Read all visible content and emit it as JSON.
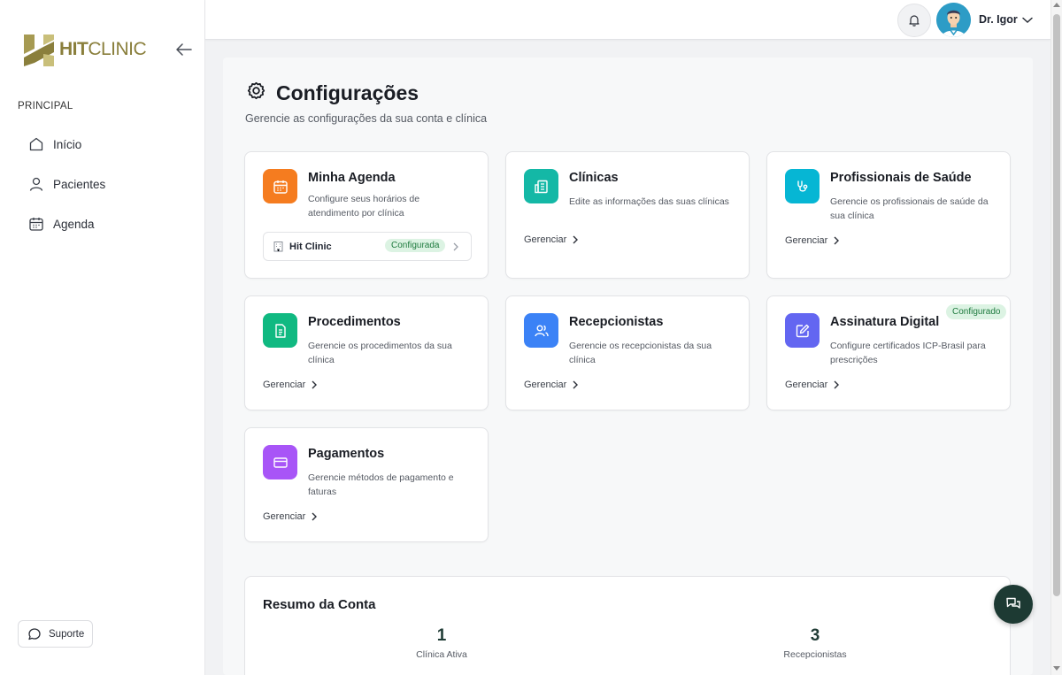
{
  "brand": {
    "logo_bold": "HIT",
    "logo_rest": "CLINIC",
    "logo_colors": [
      "#8a7f3c",
      "#a69a52",
      "#c9bf7a"
    ]
  },
  "sidebar": {
    "section_label": "PRINCIPAL",
    "items": [
      {
        "label": "Início",
        "icon": "home-icon"
      },
      {
        "label": "Pacientes",
        "icon": "user-icon"
      },
      {
        "label": "Agenda",
        "icon": "calendar-icon"
      }
    ],
    "support_label": "Suporte"
  },
  "header": {
    "user_name": "Dr. Igor"
  },
  "page": {
    "title": "Configurações",
    "subtitle": "Gerencie as configurações da sua conta e clínica"
  },
  "cards": [
    {
      "title": "Minha Agenda",
      "desc": "Configure seus horários de atendimento por clínica",
      "color": "#f57c1f",
      "icon": "calendar-icon",
      "clinic_name": "Hit Clinic",
      "clinic_status": "Configurada"
    },
    {
      "title": "Clínicas",
      "desc": "Edite as informações das suas clínicas",
      "color": "#14b8a6",
      "icon": "building-icon",
      "manage": "Gerenciar"
    },
    {
      "title": "Profissionais de Saúde",
      "desc": "Gerencie os profissionais de saúde da sua clínica",
      "color": "#06b6d4",
      "icon": "stethoscope-icon",
      "manage": "Gerenciar"
    },
    {
      "title": "Procedimentos",
      "desc": "Gerencie os procedimentos da sua clínica",
      "color": "#10b981",
      "icon": "document-icon",
      "manage": "Gerenciar"
    },
    {
      "title": "Recepcionistas",
      "desc": "Gerencie os recepcionistas da sua clínica",
      "color": "#3b82f6",
      "icon": "users-icon",
      "manage": "Gerenciar"
    },
    {
      "title": "Assinatura Digital",
      "desc": "Configure certificados ICP-Brasil para prescrições",
      "color": "#6366f1",
      "icon": "signature-icon",
      "manage": "Gerenciar",
      "badge": "Configurado"
    },
    {
      "title": "Pagamentos",
      "desc": "Gerencie métodos de pagamento e faturas",
      "color": "#a855f7",
      "icon": "credit-card-icon",
      "manage": "Gerenciar"
    }
  ],
  "summary": {
    "title": "Resumo da Conta",
    "stats": [
      {
        "value": "1",
        "label": "Clínica Ativa"
      },
      {
        "value": "3",
        "label": "Recepcionistas"
      }
    ]
  }
}
